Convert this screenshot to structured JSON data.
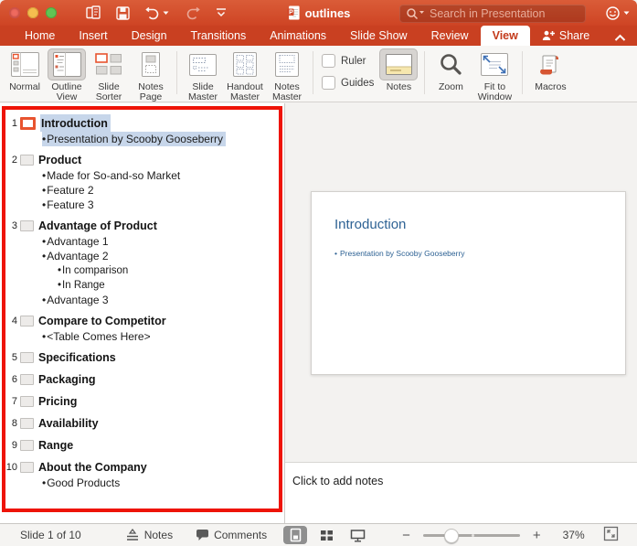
{
  "titlebar": {
    "document_title": "outlines",
    "search_placeholder": "Search in Presentation"
  },
  "tabs": [
    {
      "id": "home",
      "label": "Home"
    },
    {
      "id": "insert",
      "label": "Insert"
    },
    {
      "id": "design",
      "label": "Design"
    },
    {
      "id": "transitions",
      "label": "Transitions"
    },
    {
      "id": "animations",
      "label": "Animations"
    },
    {
      "id": "slide-show",
      "label": "Slide Show"
    },
    {
      "id": "review",
      "label": "Review"
    },
    {
      "id": "view",
      "label": "View",
      "active": true
    },
    {
      "id": "share",
      "label": "Share",
      "icon": "share-person-plus-icon"
    }
  ],
  "ribbon": {
    "buttons": {
      "normal": "Normal",
      "outline_view": "Outline View",
      "slide_sorter": "Slide Sorter",
      "notes_page": "Notes Page",
      "slide_master": "Slide Master",
      "handout_master": "Handout Master",
      "notes_master": "Notes Master",
      "notes": "Notes",
      "zoom": "Zoom",
      "fit_to_window": "Fit to Window",
      "macros": "Macros"
    },
    "checkboxes": {
      "ruler": "Ruler",
      "guides": "Guides"
    },
    "selected_buttons": [
      "Outline View",
      "Notes"
    ]
  },
  "outline": {
    "slides": [
      {
        "number": 1,
        "title": "Introduction",
        "selected": true,
        "bullets": [
          {
            "text": "Presentation by Scooby Gooseberry",
            "level": 1,
            "highlighted": true
          }
        ]
      },
      {
        "number": 2,
        "title": "Product",
        "bullets": [
          {
            "text": "Made for So-and-so Market",
            "level": 1
          },
          {
            "text": "Feature 2",
            "level": 1
          },
          {
            "text": "Feature 3",
            "level": 1
          }
        ]
      },
      {
        "number": 3,
        "title": "Advantage of Product",
        "bullets": [
          {
            "text": "Advantage 1",
            "level": 1
          },
          {
            "text": "Advantage 2",
            "level": 1
          },
          {
            "text": "In comparison",
            "level": 2
          },
          {
            "text": "In Range",
            "level": 2
          },
          {
            "text": "Advantage 3",
            "level": 1
          }
        ]
      },
      {
        "number": 4,
        "title": "Compare to Competitor",
        "bullets": [
          {
            "text": "<Table Comes Here>",
            "level": 1
          }
        ]
      },
      {
        "number": 5,
        "title": "Specifications",
        "bullets": []
      },
      {
        "number": 6,
        "title": "Packaging",
        "bullets": []
      },
      {
        "number": 7,
        "title": "Pricing",
        "bullets": []
      },
      {
        "number": 8,
        "title": "Availability",
        "bullets": []
      },
      {
        "number": 9,
        "title": "Range",
        "bullets": []
      },
      {
        "number": 10,
        "title": "About the Company",
        "bullets": [
          {
            "text": "Good Products",
            "level": 1
          }
        ]
      }
    ]
  },
  "slide_preview": {
    "title": "Introduction",
    "bullet": "Presentation by Scooby Gooseberry"
  },
  "notes_pane": {
    "placeholder": "Click to add notes"
  },
  "statusbar": {
    "slide_counter": "Slide 1 of 10",
    "notes_label": "Notes",
    "comments_label": "Comments",
    "zoom_percent": "37%"
  },
  "colors": {
    "titlebar": "#d2492a",
    "tabbar": "#c94021",
    "pane_highlight_red": "#ee1408",
    "current_slide_icon_red": "#e8542f",
    "selection_highlight": "#c7d6ea",
    "slide_text_blue": "#2e6294"
  }
}
